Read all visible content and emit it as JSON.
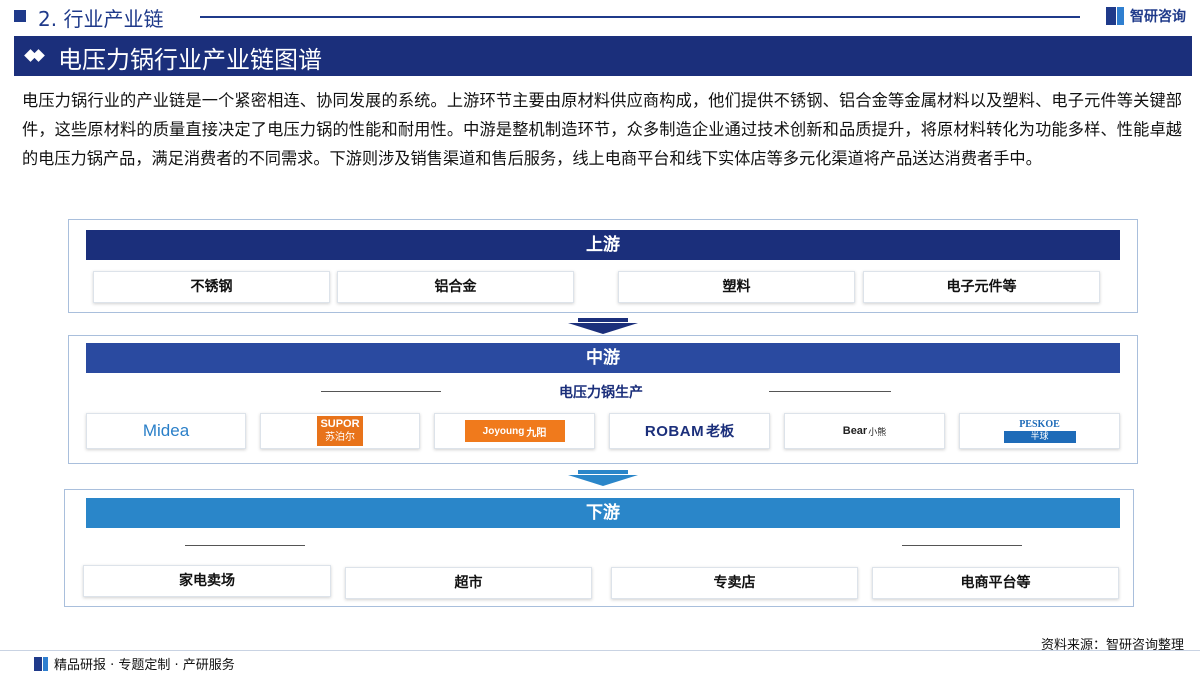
{
  "header": {
    "section": "2. 行业产业链",
    "brand": "智研咨询"
  },
  "title": "电压力锅行业产业链图谱",
  "intro": "电压力锅行业的产业链是一个紧密相连、协同发展的系统。上游环节主要由原材料供应商构成，他们提供不锈钢、铝合金等金属材料以及塑料、电子元件等关键部件，这些原材料的质量直接决定了电压力锅的性能和耐用性。中游是整机制造环节，众多制造企业通过技术创新和品质提升，将原材料转化为功能多样、性能卓越的电压力锅产品，满足消费者的不同需求。下游则涉及销售渠道和售后服务，线上电商平台和线下实体店等多元化渠道将产品送达消费者手中。",
  "upstream": {
    "label": "上游",
    "items": [
      "不锈钢",
      "铝合金",
      "塑料",
      "电子元件等"
    ]
  },
  "midstream": {
    "label": "中游",
    "subtitle": "电压力锅生产",
    "brands": [
      {
        "name": "Midea",
        "color": "#2a7fc8"
      },
      {
        "name": "SUPOR",
        "sub": "苏泊尔",
        "color": "#e8731a"
      },
      {
        "name": "Joyoung",
        "sub": "九阳",
        "color": "#f07a1c"
      },
      {
        "name": "ROBAM",
        "sub": "老板",
        "color": "#1b2f7b"
      },
      {
        "name": "Bear",
        "sub": "小熊",
        "color": "#222222"
      },
      {
        "name": "PESKOE",
        "sub": "半球",
        "color": "#1e6bb8"
      }
    ]
  },
  "downstream": {
    "label": "下游",
    "items": [
      "家电卖场",
      "超市",
      "专卖店",
      "电商平台等"
    ]
  },
  "footer": {
    "source": "资料来源：智研咨询整理",
    "tagline": "精品研报 · 专题定制 · 产研服务"
  },
  "colors": {
    "navy": "#1b2f7b",
    "midblue": "#2a4aa0",
    "lightblue": "#2a86c9"
  }
}
